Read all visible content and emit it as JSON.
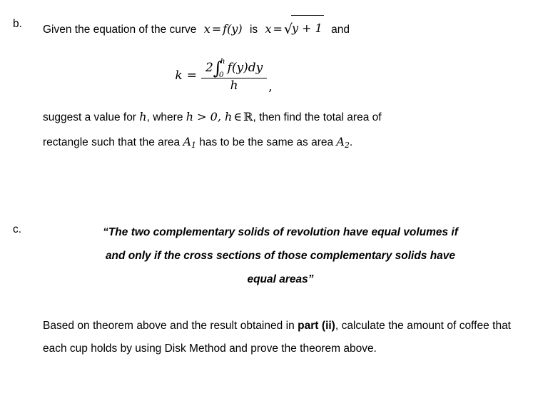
{
  "document": {
    "background_color": "#ffffff",
    "text_color": "#000000"
  },
  "questions": [
    {
      "label": "b.",
      "line1": {
        "text_before": "Given  the  equation  of  the  curve",
        "math_curve_lhs": "x",
        "math_equals": "=",
        "math_fy": "f(y)",
        "text_is": "is",
        "math_x2": "x",
        "math_equals2": "=",
        "sqrt_symbol": "√",
        "radicand": "y + 1",
        "text_after": "and"
      },
      "formula": {
        "lhs": "k",
        "equals": "=",
        "numerator_coefficient": "2",
        "integral_symbol": "∫",
        "integral_upper_limit": "h",
        "integral_lower_limit": "0",
        "integrand": "f(y)dy",
        "denominator": "h",
        "trailing_punctuation": ","
      },
      "line2": {
        "part1": "suggest a value for",
        "math_h": "h",
        "part2": ", where",
        "math_condition": "h > 0, h",
        "math_element_of": "∈",
        "math_reals": "ℝ",
        "part3": ", then find the total area of"
      },
      "line3": {
        "part1": "rectangle such that the area",
        "math_A1_base": "A",
        "math_A1_sub": "1",
        "part2": "has to be the same as area",
        "math_A2_base": "A",
        "math_A2_sub": "2",
        "part3": "."
      }
    },
    {
      "label": "c.",
      "quote_lines": [
        "“The two complementary solids of revolution have equal volumes if",
        "and only if the cross sections of those complementary solids have",
        "equal areas”"
      ],
      "closing_paragraph": {
        "part1": "Based on theorem above and the result obtained in ",
        "bold_reference": "part (ii)",
        "part2": ", calculate the amount of coffee that each cup holds by using Disk Method and prove the theorem above."
      }
    }
  ]
}
